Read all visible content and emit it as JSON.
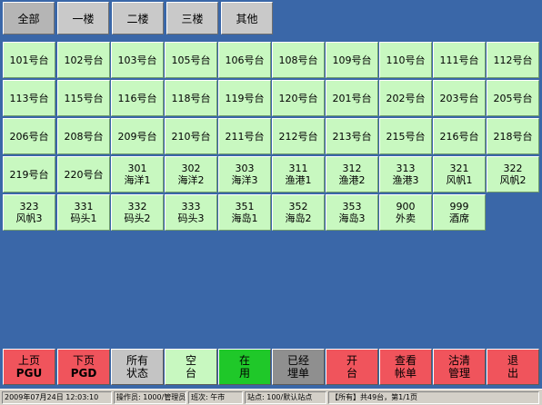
{
  "floor_tabs": [
    {
      "label": "全部",
      "active": true
    },
    {
      "label": "一楼",
      "active": false
    },
    {
      "label": "二楼",
      "active": false
    },
    {
      "label": "三楼",
      "active": false
    },
    {
      "label": "其他",
      "active": false
    }
  ],
  "tables": [
    {
      "line1": "101号台",
      "line2": ""
    },
    {
      "line1": "102号台",
      "line2": ""
    },
    {
      "line1": "103号台",
      "line2": ""
    },
    {
      "line1": "105号台",
      "line2": ""
    },
    {
      "line1": "106号台",
      "line2": ""
    },
    {
      "line1": "108号台",
      "line2": ""
    },
    {
      "line1": "109号台",
      "line2": ""
    },
    {
      "line1": "110号台",
      "line2": ""
    },
    {
      "line1": "111号台",
      "line2": ""
    },
    {
      "line1": "112号台",
      "line2": ""
    },
    {
      "line1": "113号台",
      "line2": ""
    },
    {
      "line1": "115号台",
      "line2": ""
    },
    {
      "line1": "116号台",
      "line2": ""
    },
    {
      "line1": "118号台",
      "line2": ""
    },
    {
      "line1": "119号台",
      "line2": ""
    },
    {
      "line1": "120号台",
      "line2": ""
    },
    {
      "line1": "201号台",
      "line2": ""
    },
    {
      "line1": "202号台",
      "line2": ""
    },
    {
      "line1": "203号台",
      "line2": ""
    },
    {
      "line1": "205号台",
      "line2": ""
    },
    {
      "line1": "206号台",
      "line2": ""
    },
    {
      "line1": "208号台",
      "line2": ""
    },
    {
      "line1": "209号台",
      "line2": ""
    },
    {
      "line1": "210号台",
      "line2": ""
    },
    {
      "line1": "211号台",
      "line2": ""
    },
    {
      "line1": "212号台",
      "line2": ""
    },
    {
      "line1": "213号台",
      "line2": ""
    },
    {
      "line1": "215号台",
      "line2": ""
    },
    {
      "line1": "216号台",
      "line2": ""
    },
    {
      "line1": "218号台",
      "line2": ""
    },
    {
      "line1": "219号台",
      "line2": ""
    },
    {
      "line1": "220号台",
      "line2": ""
    },
    {
      "line1": "301",
      "line2": "海洋1"
    },
    {
      "line1": "302",
      "line2": "海洋2"
    },
    {
      "line1": "303",
      "line2": "海洋3"
    },
    {
      "line1": "311",
      "line2": "渔港1"
    },
    {
      "line1": "312",
      "line2": "渔港2"
    },
    {
      "line1": "313",
      "line2": "渔港3"
    },
    {
      "line1": "321",
      "line2": "风帆1"
    },
    {
      "line1": "322",
      "line2": "风帆2"
    },
    {
      "line1": "323",
      "line2": "风帆3"
    },
    {
      "line1": "331",
      "line2": "码头1"
    },
    {
      "line1": "332",
      "line2": "码头2"
    },
    {
      "line1": "333",
      "line2": "码头3"
    },
    {
      "line1": "351",
      "line2": "海岛1"
    },
    {
      "line1": "352",
      "line2": "海岛2"
    },
    {
      "line1": "353",
      "line2": "海岛3"
    },
    {
      "line1": "900",
      "line2": "外卖"
    },
    {
      "line1": "999",
      "line2": "酒席"
    }
  ],
  "actions": [
    {
      "line1": "上页",
      "line2": "PGU",
      "color": "red",
      "bold2": true
    },
    {
      "line1": "下页",
      "line2": "PGD",
      "color": "red",
      "bold2": true
    },
    {
      "line1": "所有",
      "line2": "状态",
      "color": "gray",
      "bold2": false
    },
    {
      "line1": "空",
      "line2": "台",
      "color": "mint",
      "bold2": false
    },
    {
      "line1": "在",
      "line2": "用",
      "color": "green",
      "bold2": false
    },
    {
      "line1": "已经",
      "line2": "埋单",
      "color": "dgray",
      "bold2": false
    },
    {
      "line1": "开",
      "line2": "台",
      "color": "red",
      "bold2": false
    },
    {
      "line1": "查看",
      "line2": "帐单",
      "color": "red",
      "bold2": false
    },
    {
      "line1": "沽清",
      "line2": "管理",
      "color": "red",
      "bold2": false
    },
    {
      "line1": "退",
      "line2": "出",
      "color": "red",
      "bold2": false
    }
  ],
  "status_bar": {
    "datetime": "2009年07月24日 12:03:10",
    "operator": "操作员:    1000/管理员",
    "shift": "班次:     午市",
    "station": "站点:     100/默认站点",
    "summary": "【所有】共49台，第1/1页"
  },
  "colors": {
    "background": "#3a67a8",
    "table_free": "#c8f8c0",
    "button_red": "#f0545c",
    "button_green": "#1fc829"
  }
}
